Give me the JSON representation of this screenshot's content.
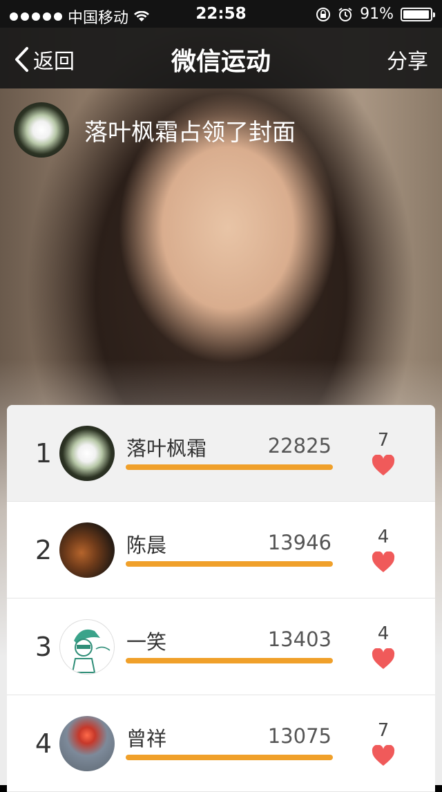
{
  "status_bar": {
    "carrier": "中国移动",
    "time": "22:58",
    "battery": "91%"
  },
  "nav": {
    "back_label": "返回",
    "title": "微信运动",
    "share_label": "分享"
  },
  "cover": {
    "owner_text": "落叶枫霜占领了封面"
  },
  "ranking": [
    {
      "rank": "1",
      "name": "落叶枫霜",
      "steps": "22825",
      "likes": "7"
    },
    {
      "rank": "2",
      "name": "陈晨",
      "steps": "13946",
      "likes": "4"
    },
    {
      "rank": "3",
      "name": "一笑",
      "steps": "13403",
      "likes": "4"
    },
    {
      "rank": "4",
      "name": "曾祥",
      "steps": "13075",
      "likes": "7"
    }
  ],
  "colors": {
    "progress_bar": "#f0a02a",
    "heart": "#f05a5a",
    "nav_background": "#191919"
  },
  "icons": {
    "back": "chevron-left-icon",
    "heart": "heart-icon",
    "wifi": "wifi-icon",
    "lock_rotation": "rotation-lock-icon",
    "alarm": "alarm-icon",
    "battery": "battery-icon"
  }
}
